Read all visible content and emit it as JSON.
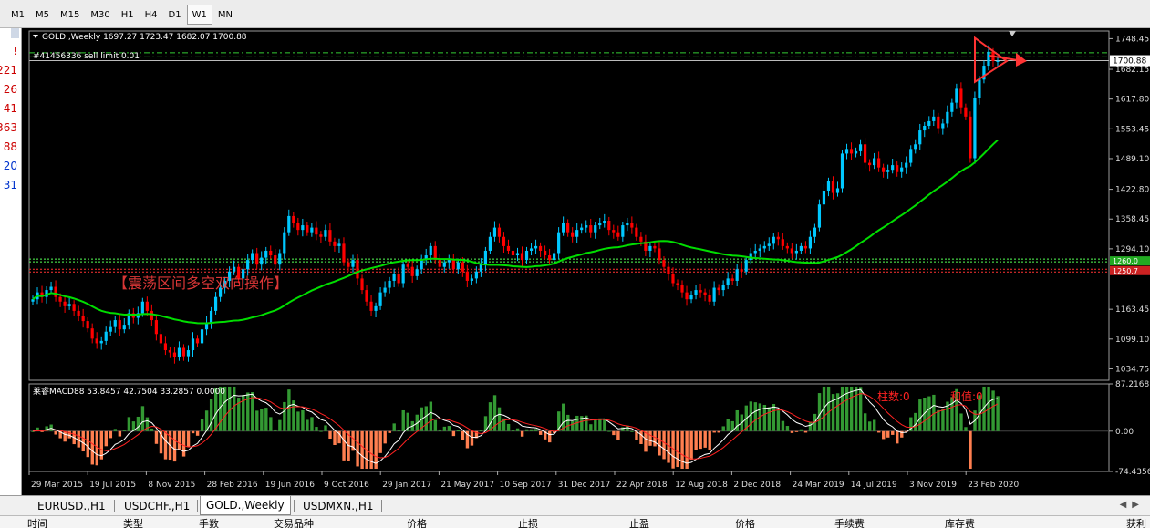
{
  "timeframes": [
    "M1",
    "M5",
    "M15",
    "M30",
    "H1",
    "H4",
    "D1",
    "W1",
    "MN"
  ],
  "active_timeframe": "W1",
  "left_panel": {
    "values": [
      {
        "text": "!",
        "color": "#cc0000"
      },
      {
        "text": "221",
        "color": "#cc0000"
      },
      {
        "text": "26",
        "color": "#cc0000"
      },
      {
        "text": "41",
        "color": "#cc0000"
      },
      {
        "text": "363",
        "color": "#cc0000"
      },
      {
        "text": "88",
        "color": "#cc0000"
      },
      {
        "text": "20",
        "color": "#0033cc"
      },
      {
        "text": "31",
        "color": "#0033cc"
      }
    ]
  },
  "chart": {
    "header": "GOLD.,Weekly  1697.27 1723.47 1682.07 1700.88",
    "order_label": "#41456336 sell limit 0.01",
    "watermark": "【震荡区间多空双向操作】",
    "price_axis": [
      "1748.45",
      "1682.15",
      "1617.80",
      "1553.45",
      "1489.10",
      "1422.80",
      "1358.45",
      "1294.10",
      "1163.45",
      "1099.10",
      "1034.75"
    ],
    "current_price": "1700.88",
    "right_labels": [
      "1260.0",
      "1250.7"
    ],
    "macd_label": "莱睿MACD88 53.8457 42.7504 33.2857 0.0000",
    "macd_annot1": "柱数:0",
    "macd_annot2": "和值:0",
    "macd_axis": [
      "87.2168",
      "0.00",
      "-74.4356"
    ],
    "time_axis": [
      "29 Mar 2015",
      "19 Jul 2015",
      "8 Nov 2015",
      "28 Feb 2016",
      "19 Jun 2016",
      "9 Oct 2016",
      "29 Jan 2017",
      "21 May 2017",
      "10 Sep 2017",
      "31 Dec 2017",
      "22 Apr 2018",
      "12 Aug 2018",
      "2 Dec 2018",
      "24 Mar 2019",
      "14 Jul 2019",
      "3 Nov 2019",
      "23 Feb 2020"
    ],
    "colors": {
      "bull": "#00c8ff",
      "bear": "#ff0000",
      "ma": "#00dd00",
      "macd_pos": "#339933",
      "macd_neg": "#ff7f50",
      "grid": "#2a2a2a"
    },
    "series_close": [
      1185,
      1200,
      1190,
      1205,
      1212,
      1190,
      1180,
      1170,
      1175,
      1160,
      1150,
      1138,
      1122,
      1100,
      1090,
      1095,
      1115,
      1125,
      1140,
      1120,
      1130,
      1155,
      1145,
      1155,
      1180,
      1160,
      1140,
      1110,
      1090,
      1075,
      1070,
      1060,
      1080,
      1062,
      1075,
      1100,
      1090,
      1120,
      1135,
      1160,
      1190,
      1210,
      1225,
      1245,
      1255,
      1230,
      1250,
      1270,
      1285,
      1260,
      1275,
      1290,
      1280,
      1260,
      1285,
      1330,
      1365,
      1350,
      1335,
      1345,
      1330,
      1340,
      1325,
      1320,
      1335,
      1310,
      1300,
      1305,
      1265,
      1255,
      1270,
      1230,
      1205,
      1180,
      1160,
      1170,
      1200,
      1210,
      1225,
      1240,
      1220,
      1260,
      1255,
      1235,
      1250,
      1270,
      1280,
      1300,
      1270,
      1255,
      1265,
      1270,
      1250,
      1265,
      1245,
      1225,
      1230,
      1245,
      1260,
      1290,
      1320,
      1340,
      1320,
      1300,
      1290,
      1280,
      1285,
      1270,
      1290,
      1295,
      1300,
      1290,
      1280,
      1270,
      1285,
      1330,
      1350,
      1330,
      1320,
      1335,
      1340,
      1345,
      1330,
      1345,
      1350,
      1355,
      1335,
      1330,
      1320,
      1345,
      1350,
      1340,
      1320,
      1310,
      1290,
      1300,
      1295,
      1270,
      1255,
      1240,
      1220,
      1215,
      1200,
      1185,
      1195,
      1205,
      1200,
      1195,
      1180,
      1210,
      1205,
      1215,
      1230,
      1225,
      1250,
      1245,
      1270,
      1285,
      1290,
      1295,
      1300,
      1305,
      1320,
      1315,
      1300,
      1295,
      1285,
      1290,
      1300,
      1295,
      1320,
      1340,
      1390,
      1420,
      1440,
      1415,
      1425,
      1500,
      1510,
      1500,
      1505,
      1520,
      1480,
      1475,
      1490,
      1470,
      1460,
      1465,
      1475,
      1460,
      1470,
      1480,
      1510,
      1520,
      1550,
      1560,
      1570,
      1580,
      1555,
      1565,
      1590,
      1610,
      1640,
      1600,
      1580,
      1490,
      1620,
      1660,
      1690,
      1720,
      1700,
      1700
    ]
  }
}
